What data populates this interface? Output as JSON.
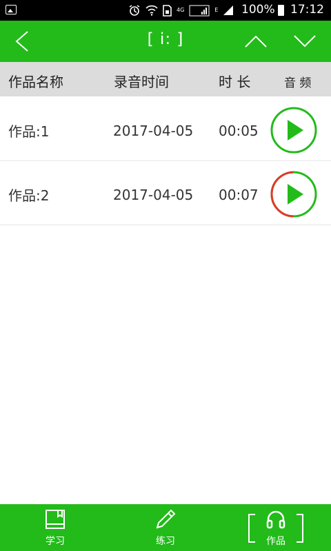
{
  "status_bar": {
    "network_4g": "4G",
    "network_e": "E",
    "battery_percent": "100%",
    "time": "17:12",
    "icons": [
      "gallery-icon",
      "alarm-icon",
      "wifi-icon",
      "sim-icon",
      "signal-icon",
      "battery-icon"
    ]
  },
  "header": {
    "title": "[ i: ]",
    "icons": [
      "back-arrow-icon",
      "chevron-up-icon",
      "chevron-down-icon"
    ],
    "background": "#22bb1a"
  },
  "columns": {
    "name": "作品名称",
    "time": "录音时间",
    "duration": "时 长",
    "audio": "音 频"
  },
  "recordings": [
    {
      "name": "作品:1",
      "date": "2017-04-05",
      "duration": "00:05",
      "play_progress": 0
    },
    {
      "name": "作品:2",
      "date": "2017-04-05",
      "duration": "00:07",
      "play_progress": 0.5
    }
  ],
  "tabs": [
    {
      "label": "学习",
      "icon": "book-icon"
    },
    {
      "label": "练习",
      "icon": "pencil-icon"
    },
    {
      "label": "作品",
      "icon": "headphones-icon",
      "selected": true
    }
  ],
  "colors": {
    "accent": "#22bb1a",
    "progress": "#e0392a"
  }
}
